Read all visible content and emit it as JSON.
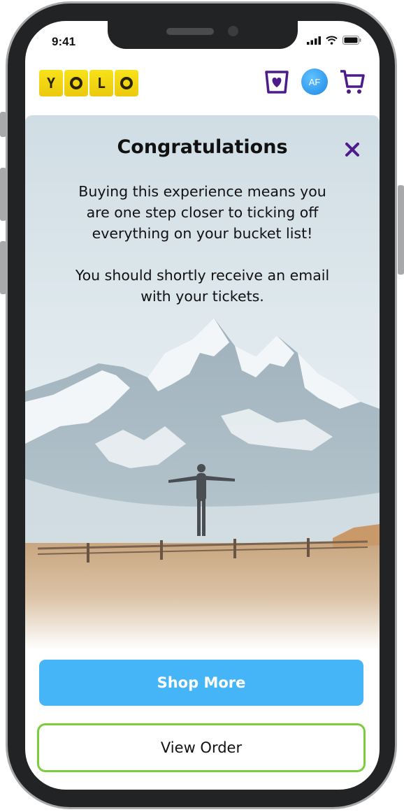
{
  "status_bar": {
    "time": "9:41"
  },
  "header": {
    "logo_letters": [
      "Y",
      "",
      "L",
      ""
    ],
    "icons": [
      "wishlist-heart-icon",
      "avatar",
      "cart-icon"
    ],
    "avatar_initials": "AF"
  },
  "modal": {
    "title": "Congratulations",
    "message_line_1": "Buying this experience means you",
    "message_line_2": "are one step closer to ticking off",
    "message_line_3": "everything on your bucket list!",
    "message_line_4": "You should shortly receive an email",
    "message_line_5": "with your tickets."
  },
  "actions": {
    "shop_more_label": "Shop More",
    "view_order_label": "View Order"
  },
  "colors": {
    "logo_yellow": "#f4dc16",
    "accent_purple": "#4b1c8a",
    "primary_blue": "#46b5f7",
    "secondary_border_green": "#7ccd3b"
  }
}
